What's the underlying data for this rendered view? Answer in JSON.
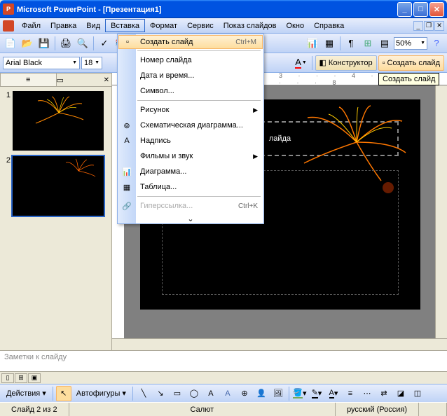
{
  "title": {
    "app": "Microsoft PowerPoint",
    "sep": " - ",
    "doc": "[Презентация1]"
  },
  "menubar": {
    "file": "Файл",
    "edit": "Правка",
    "view": "Вид",
    "insert": "Вставка",
    "format": "Формат",
    "tools": "Сервис",
    "slideshow": "Показ слайдов",
    "window": "Окно",
    "help": "Справка"
  },
  "toolbar": {
    "zoom": "50%"
  },
  "fmt": {
    "font": "Arial Black",
    "size": "18",
    "design": "Конструктор",
    "newslide": "Создать слайд"
  },
  "menu": {
    "newslide": "Создать слайд",
    "newslide_sc": "Ctrl+M",
    "slidenum": "Номер слайда",
    "datetime": "Дата и время...",
    "symbol": "Символ...",
    "picture": "Рисунок",
    "diagram": "Схематическая диаграмма...",
    "textbox": "Надпись",
    "movies": "Фильмы и звук",
    "chart": "Диаграмма...",
    "table": "Таблица...",
    "hyperlink": "Гиперссылка...",
    "hyperlink_sc": "Ctrl+K"
  },
  "tooltip": "Создать слайд",
  "slides": {
    "n1": "1",
    "n2": "2"
  },
  "canvas": {
    "title_text": "лайда"
  },
  "notes": {
    "placeholder": "Заметки к слайду"
  },
  "draw": {
    "actions": "Действия",
    "autoshapes": "Автофигуры"
  },
  "status": {
    "slide": "Слайд 2 из 2",
    "theme": "Салют",
    "lang": "русский (Россия)"
  },
  "ruler": "1 · · · 2 · · · 3 · · · 4 · · · 5 · · · 6 · · · 7 · · · 8"
}
